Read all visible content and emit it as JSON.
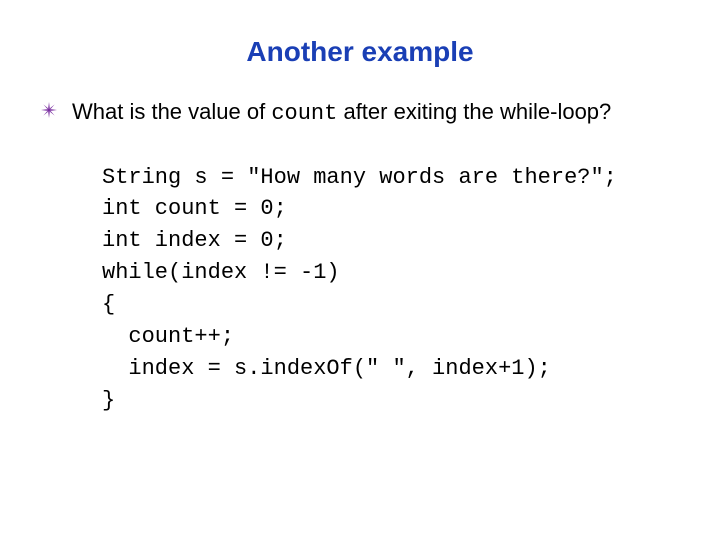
{
  "title": "Another example",
  "body": {
    "prefix": "What is the value of ",
    "code_term": "count",
    "suffix": " after exiting the while-loop?"
  },
  "code_lines": {
    "l1": "String s = \"How many words are there?\";",
    "l2": "int count = 0;",
    "l3": "int index = 0;",
    "l4": "while(index != -1)",
    "l5": "{",
    "l6": "  count++;",
    "l7": "  index = s.indexOf(\" \", index+1);",
    "l8": "}"
  },
  "colors": {
    "title": "#1a3fb5",
    "bullet": "#7a2fa0"
  }
}
